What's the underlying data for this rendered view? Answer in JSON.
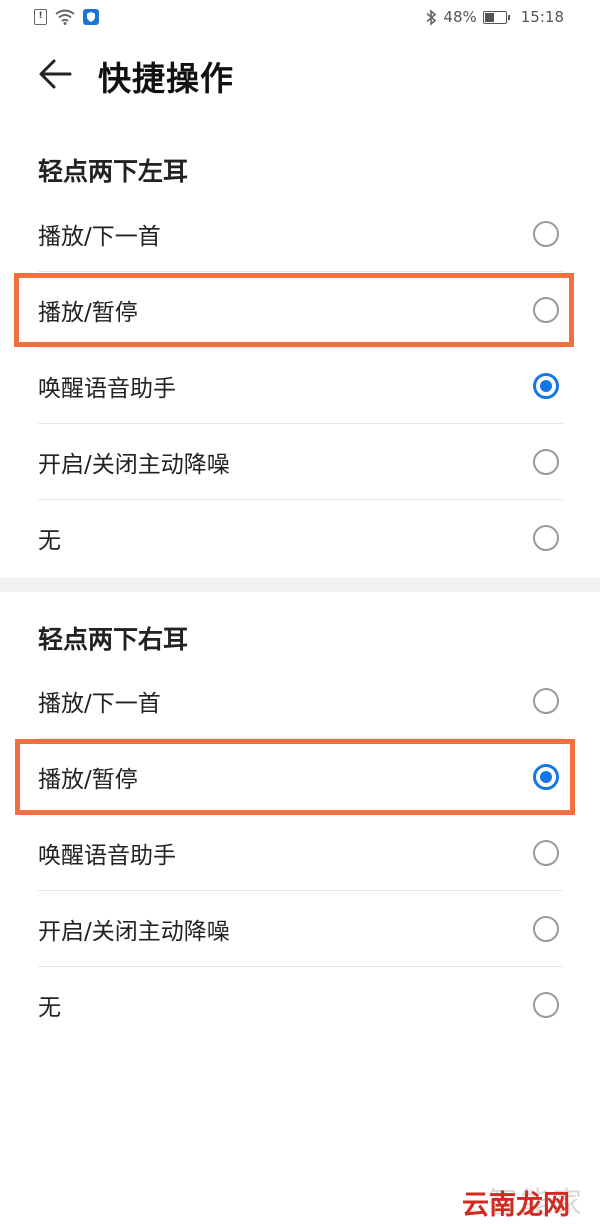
{
  "status_bar": {
    "battery_percent": "48%",
    "battery_level": 0.48,
    "time": "15:18",
    "left_icons": [
      "sim-alert-icon",
      "wifi-icon",
      "shield-app-icon"
    ],
    "right_icons": [
      "bluetooth-icon",
      "battery-icon"
    ]
  },
  "header": {
    "back_icon": "back-arrow-icon",
    "title": "快捷操作"
  },
  "sections": [
    {
      "title": "轻点两下左耳",
      "options": [
        {
          "label": "播放/下一首",
          "selected": false
        },
        {
          "label": "播放/暂停",
          "selected": false
        },
        {
          "label": "唤醒语音助手",
          "selected": true
        },
        {
          "label": "开启/关闭主动降噪",
          "selected": false
        },
        {
          "label": "无",
          "selected": false
        }
      ]
    },
    {
      "title": "轻点两下右耳",
      "options": [
        {
          "label": "播放/下一首",
          "selected": false
        },
        {
          "label": "播放/暂停",
          "selected": true
        },
        {
          "label": "唤醒语音助手",
          "selected": false
        },
        {
          "label": "开启/关闭主动降噪",
          "selected": false
        },
        {
          "label": "无",
          "selected": false
        }
      ]
    }
  ],
  "colors": {
    "accent": "#1576e8",
    "highlight": "#f27040"
  },
  "watermark": {
    "line1": "智能家",
    "line2": "云南龙网"
  }
}
